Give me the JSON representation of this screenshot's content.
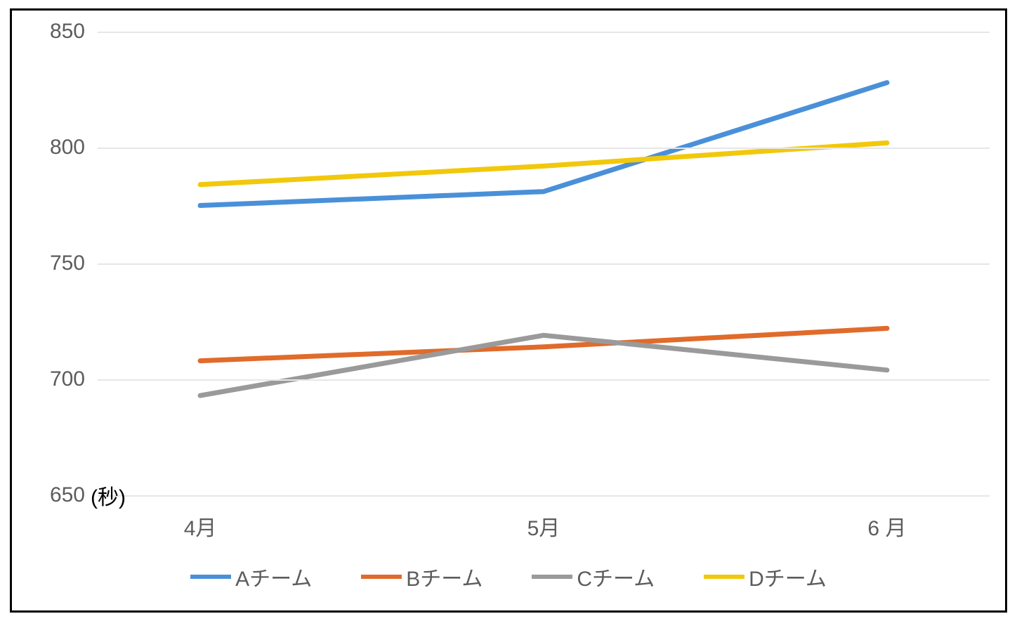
{
  "chart_data": {
    "type": "line",
    "categories": [
      "4月",
      "5月",
      "6 月"
    ],
    "series": [
      {
        "name": "Aチーム",
        "color": "#4a90d9",
        "values": [
          775,
          781,
          828
        ]
      },
      {
        "name": "Bチーム",
        "color": "#e06b2b",
        "values": [
          708,
          714,
          722
        ]
      },
      {
        "name": "Cチーム",
        "color": "#9a9a9a",
        "values": [
          693,
          719,
          704
        ]
      },
      {
        "name": "Dチーム",
        "color": "#f1c80b",
        "values": [
          784,
          792,
          802
        ]
      }
    ],
    "ylim": [
      650,
      850
    ],
    "yticks": [
      650,
      700,
      750,
      800,
      850
    ],
    "y_unit_label": "(秒)",
    "xlabel": "",
    "ylabel": "",
    "title": ""
  }
}
